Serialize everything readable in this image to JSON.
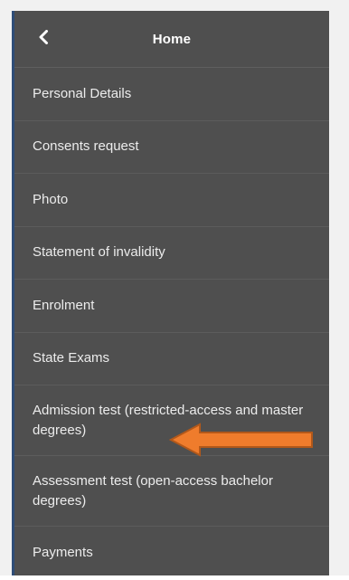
{
  "header": {
    "title": "Home",
    "back_icon": "chevron-left-icon"
  },
  "menu": {
    "items": [
      {
        "label": "Personal Details"
      },
      {
        "label": "Consents request"
      },
      {
        "label": "Photo"
      },
      {
        "label": "Statement of invalidity"
      },
      {
        "label": "Enrolment"
      },
      {
        "label": "State Exams"
      },
      {
        "label": "Admission test (restricted-access and master degrees)"
      },
      {
        "label": "Assessment test (open-access bachelor degrees)"
      },
      {
        "label": "Payments"
      }
    ]
  },
  "annotation": {
    "icon": "left-arrow-callout-icon",
    "color": "#ef7c2c",
    "outline": "#b2581a"
  },
  "colors": {
    "panel_bg": "#4f4f4f",
    "divider": "#5c5c5c",
    "left_accent": "#2f4d77",
    "text": "#ececec"
  }
}
